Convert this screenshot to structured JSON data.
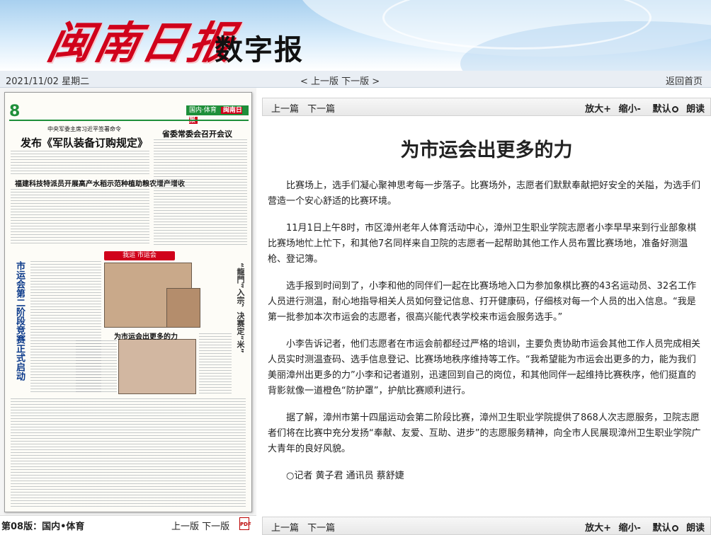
{
  "banner": {
    "logo": "闽南日报",
    "subtitle": "数字报"
  },
  "datebar": {
    "date": "2021/11/02",
    "weekday": "星期二",
    "prev_edition": "< 上一版",
    "next_edition": "下一版 >",
    "home": "返回首页"
  },
  "thumbnail": {
    "page_number": "8",
    "masthead_section": "国内·体育",
    "masthead_logo": "闽南日报",
    "top_kicker": "中央军委主席习近平签署命令",
    "headline_main": "发布《军队装备订购规定》",
    "headline_second": "福建科技特派员开展高产水稻示范种植助粮农增产增收",
    "headline_right": "省委常委会召开会议",
    "vertical_headline": "市运会第二阶段竞赛正式启动",
    "vertical_right": "“龍門”入宗，决赛定“米”",
    "ribbon": "我运 市运会",
    "photo_caption": "为市运会出更多的力"
  },
  "left_footer": {
    "edition": "第08版：国内•体育",
    "prev": "上一版",
    "next": "下一版",
    "pdf_icon": "PDF"
  },
  "toolbar": {
    "prev_article": "上一篇",
    "next_article": "下一篇",
    "zoom_in": "放大+",
    "zoom_out": "缩小-",
    "default": "默认",
    "read_aloud": "朗读"
  },
  "article": {
    "title": "为市运会出更多的力",
    "paragraphs": [
      "比赛场上，选手们凝心聚神思考每一步落子。比赛场外，志愿者们默默奉献把好安全的关隘，为选手们营造一个安心舒适的比赛环境。",
      "11月1日上午8时，市区漳州老年人体育活动中心，漳州卫生职业学院志愿者小李早早来到行业部象棋比赛场地忙上忙下，和其他7名同样来自卫院的志愿者一起帮助其他工作人员布置比赛场地，准备好测温枪、登记簿。",
      "选手报到时间到了，小李和他的同伴们一起在比赛场地入口为参加象棋比赛的43名运动员、32名工作人员进行测温，耐心地指导相关人员如何登记信息、打开健康码，仔细核对每一个人员的出入信息。“我是第一批参加本次市运会的志愿者，很高兴能代表学校来市运会服务选手。”",
      "小李告诉记者，他们志愿者在市运会前都经过严格的培训，主要负责协助市运会其他工作人员完成相关人员实时测温查码、选手信息登记、比赛场地秩序维持等工作。“我希望能为市运会出更多的力，能为我们美丽漳州出更多的力”小李和记者道别，迅速回到自己的岗位，和其他同伴一起维持比赛秩序，他们挺直的背影就像一道橙色“防护罩”，护航比赛顺利进行。",
      "据了解，漳州市第十四届运动会第二阶段比赛，漳州卫生职业学院提供了868人次志愿服务，卫院志愿者们将在比赛中充分发扬“奉献、友爱、互助、进步”的志愿服务精神，向全市人民展现漳州卫生职业学院广大青年的良好风貌。"
    ],
    "byline": "○记者 黄子君 通讯员 蔡舒婕"
  }
}
